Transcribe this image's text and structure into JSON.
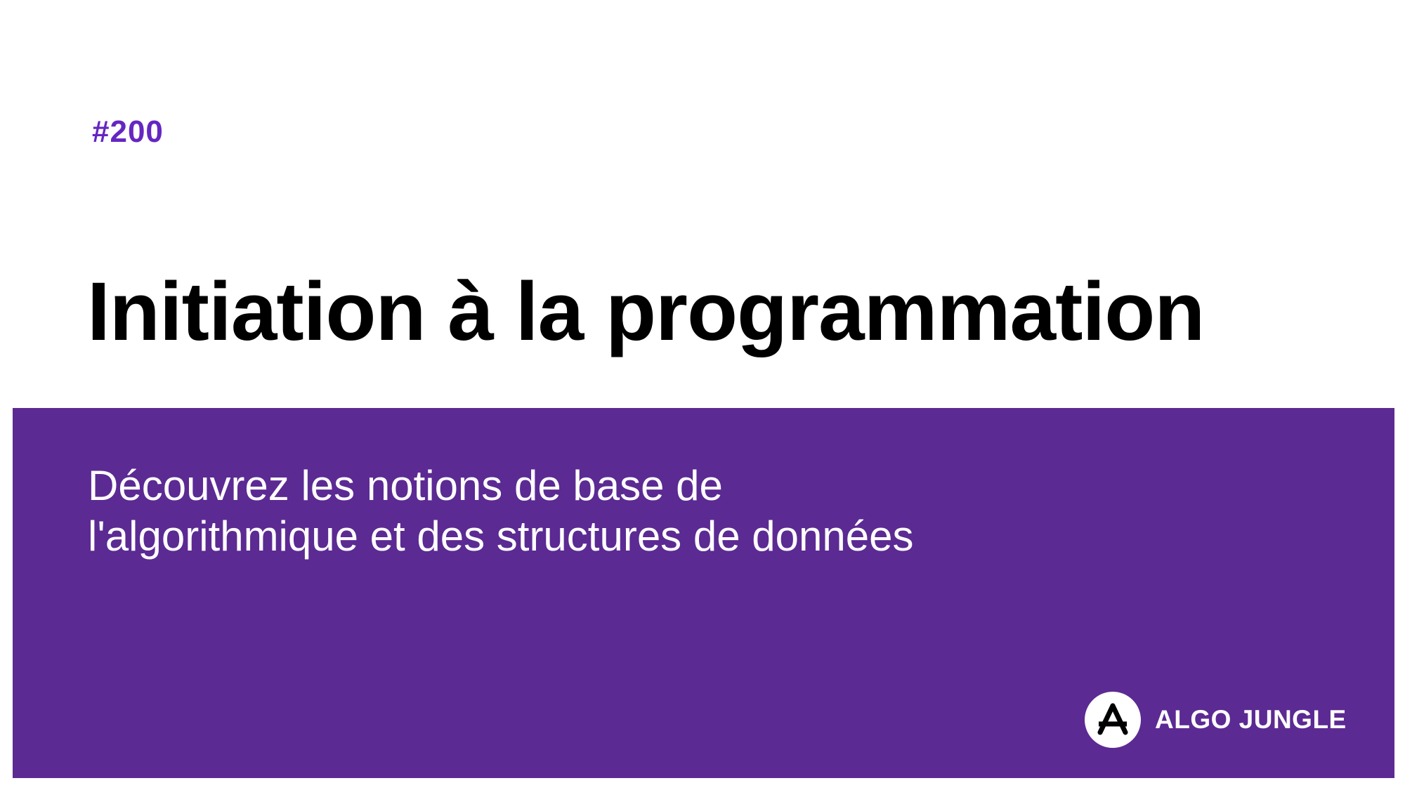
{
  "course": {
    "number": "#200",
    "title": "Initiation à la programmation",
    "subtitle_lines": [
      "Découvrez les notions de base de",
      "l'algorithmique et des structures de données"
    ]
  },
  "brand": {
    "name": "ALGO JUNGLE",
    "logo_icon": "algo-jungle-logo-icon"
  },
  "colors": {
    "accent": "#6526c1",
    "band": "#5c2a93",
    "title": "#000000",
    "background": "#ffffff"
  }
}
